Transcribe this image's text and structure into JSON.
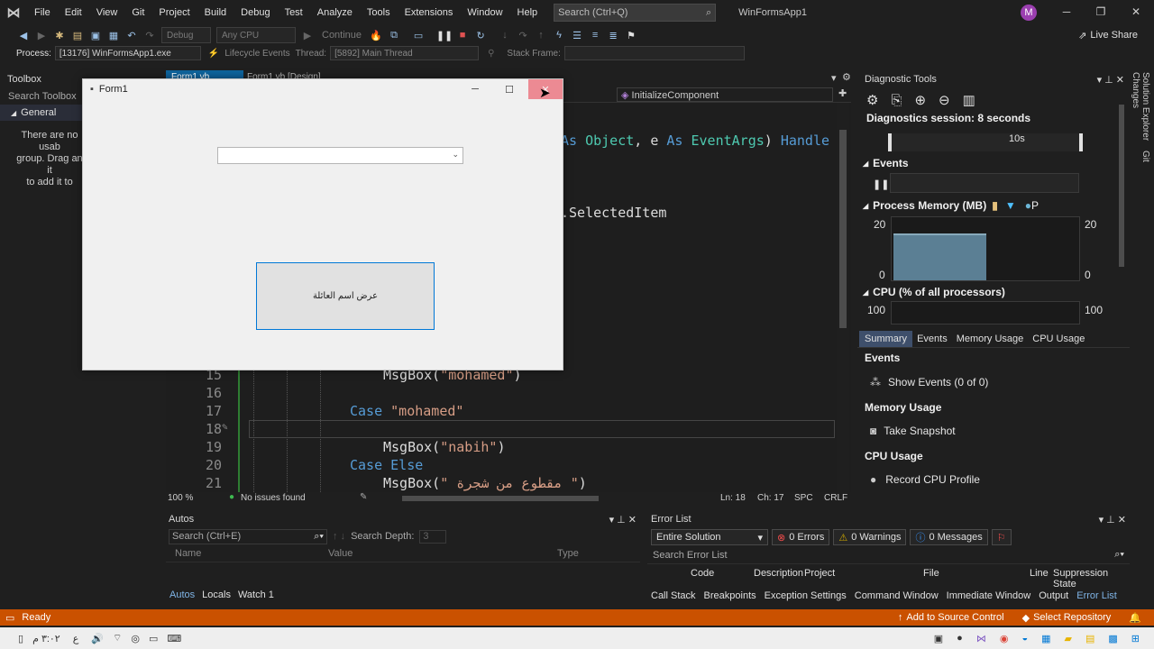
{
  "menubar": {
    "items": [
      "File",
      "Edit",
      "View",
      "Git",
      "Project",
      "Build",
      "Debug",
      "Test",
      "Analyze",
      "Tools",
      "Extensions",
      "Window",
      "Help"
    ],
    "search_placeholder": "Search (Ctrl+Q)",
    "app_title": "WinFormsApp1",
    "avatar_initial": "M"
  },
  "toolbar": {
    "config": "Debug",
    "platform": "Any CPU",
    "continue_label": "Continue",
    "live_share": "Live Share"
  },
  "debugbar": {
    "process_label": "Process:",
    "process_value": "[13176] WinFormsApp1.exe",
    "lifecycle_label": "Lifecycle Events",
    "thread_label": "Thread:",
    "thread_value": "[5892] Main Thread",
    "stackframe_label": "Stack Frame:"
  },
  "toolbox": {
    "title": "Toolbox",
    "search_placeholder": "Search Toolbox",
    "group": "General",
    "empty_message_l1": "There are no usab",
    "empty_message_l2": "group. Drag an it",
    "empty_message_l3": "to add it to"
  },
  "editor": {
    "tab_active": "Form1.vb",
    "tab_design": "Form1.vb [Design]",
    "member_dropdown": "InitializeComponent",
    "line_top1": "As Object, e As EventArgs) Handle",
    "line_top2": ".SelectedItem",
    "lines": [
      {
        "num": "15",
        "indent": "MsgBox(",
        "str": "\"mohamed\"",
        "end": ")"
      },
      {
        "num": "16"
      },
      {
        "num": "17",
        "kw": "Case ",
        "str": "\"mohamed\""
      },
      {
        "num": "18"
      },
      {
        "num": "19",
        "indent": "MsgBox(",
        "str": "\"nabih\"",
        "end": ")"
      },
      {
        "num": "20",
        "kw": "Case Else"
      },
      {
        "num": "21",
        "indent": "MsgBox(",
        "str": "\" مقطوع من شجرة \"",
        "end": ")"
      }
    ],
    "zoom": "100 %",
    "issues": "No issues found",
    "position_ln": "Ln: 18",
    "position_ch": "Ch: 17",
    "spacing": "SPC",
    "line_ending": "CRLF"
  },
  "diagnostic": {
    "title": "Diagnostic Tools",
    "session": "Diagnostics session: 8 seconds",
    "timeline_tick": "10s",
    "events_label": "Events",
    "memory_label": "Process Memory (MB)",
    "memory_legend": "P",
    "memory_max": "20",
    "memory_min": "0",
    "memory_level": 0.75,
    "cpu_label": "CPU (% of all processors)",
    "cpu_max": "100",
    "tabs": [
      "Summary",
      "Events",
      "Memory Usage",
      "CPU Usage"
    ],
    "summary_events_heading": "Events",
    "show_events": "Show Events (0 of 0)",
    "memory_heading": "Memory Usage",
    "take_snapshot": "Take Snapshot",
    "cpu_heading": "CPU Usage",
    "record_cpu": "Record CPU Profile"
  },
  "autos": {
    "title": "Autos",
    "search_placeholder": "Search (Ctrl+E)",
    "search_depth_label": "Search Depth:",
    "search_depth_value": "3",
    "columns": [
      "Name",
      "Value",
      "Type"
    ],
    "tabs": [
      "Autos",
      "Locals",
      "Watch 1"
    ]
  },
  "errorlist": {
    "title": "Error List",
    "scope": "Entire Solution",
    "errors": "0 Errors",
    "warnings": "0 Warnings",
    "messages": "0 Messages",
    "search_placeholder": "Search Error List",
    "columns": [
      "Code",
      "Description",
      "Project",
      "File",
      "Line",
      "Suppression State"
    ],
    "bottom_tabs": [
      "Call Stack",
      "Breakpoints",
      "Exception Settings",
      "Command Window",
      "Immediate Window",
      "Output",
      "Error List"
    ]
  },
  "statusbar": {
    "ready": "Ready",
    "source_control": "Add to Source Control",
    "repository": "Select Repository"
  },
  "taskbar": {
    "time": "٣:٠٢ م",
    "lang": "ع"
  },
  "form1": {
    "title": "Form1",
    "button_label": "عرض اسم العائلة"
  },
  "side_tabs": [
    "Solution Explorer",
    "Git Changes"
  ],
  "colors": {
    "status": "#ca5100",
    "accent": "#0078d4",
    "close_hover": "#e81123"
  }
}
